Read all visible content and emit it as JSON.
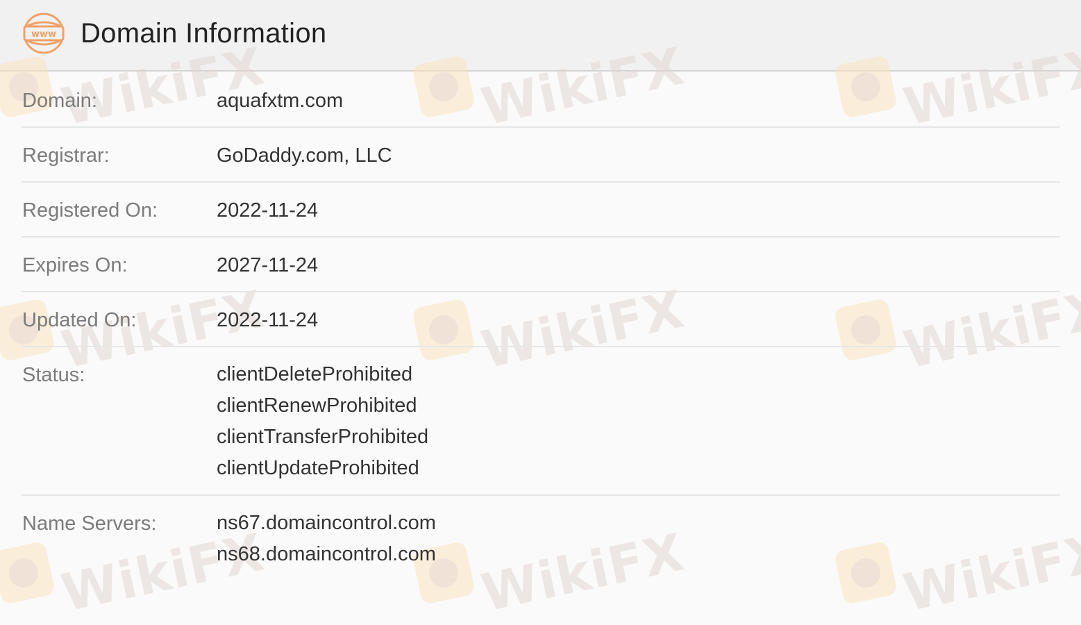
{
  "header": {
    "icon_text": "www",
    "title": "Domain Information"
  },
  "watermark": {
    "text": "WikiFX"
  },
  "rows": [
    {
      "label": "Domain:",
      "value": "aquafxtm.com"
    },
    {
      "label": "Registrar:",
      "value": "GoDaddy.com, LLC"
    },
    {
      "label": "Registered On:",
      "value": "2022-11-24"
    },
    {
      "label": "Expires On:",
      "value": "2027-11-24"
    },
    {
      "label": "Updated On:",
      "value": "2022-11-24"
    }
  ],
  "status": {
    "label": "Status:",
    "values": [
      "clientDeleteProhibited",
      "clientRenewProhibited",
      "clientTransferProhibited",
      "clientUpdateProhibited"
    ]
  },
  "name_servers": {
    "label": "Name Servers:",
    "values": [
      "ns67.domaincontrol.com",
      "ns68.domaincontrol.com"
    ]
  },
  "colors": {
    "icon_orange": "#f0a068",
    "label_gray": "#7b7b7b",
    "value_dark": "#333333",
    "header_bg": "#f1f1f1"
  }
}
